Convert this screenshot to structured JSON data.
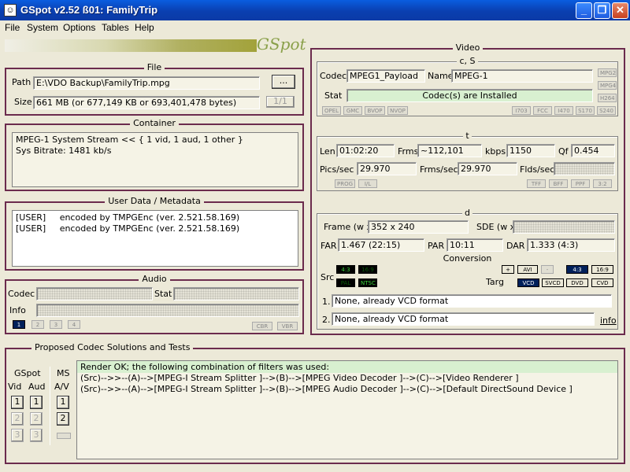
{
  "window": {
    "title": "GSpot v2.52 ß01: FamilyTrip"
  },
  "menu": [
    "File",
    "System",
    "Options",
    "Tables",
    "Help"
  ],
  "logo": "GSpot",
  "file": {
    "title": "File",
    "path_label": "Path",
    "path_value": "E:\\VDO Backup\\FamilyTrip.mpg",
    "browse_label": "...",
    "size_label": "Size",
    "size_value": "661 MB (or 677,149 KB or 693,401,478 bytes)",
    "counter": "1/1"
  },
  "container": {
    "title": "Container",
    "lines": "MPEG-1 System Stream << { 1 vid, 1 aud, 1 other }\nSys Bitrate: 1481 kb/s"
  },
  "userdata": {
    "title": "User Data / Metadata",
    "lines": "[USER]     encoded by TMPGEnc (ver. 2.521.58.169)\n[USER]     encoded by TMPGEnc (ver. 2.521.58.169)"
  },
  "audio": {
    "title": "Audio",
    "codec_label": "Codec",
    "stat_label": "Stat",
    "info_label": "Info",
    "streams": [
      "1",
      "2",
      "3",
      "4"
    ],
    "tags": [
      "CBR",
      "VBR"
    ]
  },
  "video": {
    "title": "Video",
    "cs": {
      "title": "c, S",
      "codec_label": "Codec",
      "codec_value": "MPEG1_Payload",
      "name_label": "Name",
      "name_value": "MPEG-1",
      "stat_label": "Stat",
      "stat_value": "Codec(s) are Installed",
      "side_tags": [
        "MPG2",
        "MPG4",
        "H264"
      ],
      "left_tags": [
        "OPEL",
        "GMC",
        "BVOP",
        "NVOP"
      ],
      "right_tags": [
        "I703",
        "FCC",
        "I470",
        "S170",
        "S240"
      ]
    },
    "t": {
      "title": "t",
      "len_label": "Len",
      "len_value": "01:02:20",
      "frms_label": "Frms",
      "frms_value": "~112,101",
      "kbps_label": "kbps",
      "kbps_value": "1150",
      "qf_label": "Qf",
      "qf_value": "0.454",
      "pics_label": "Pics/sec",
      "pics_value": "29.970",
      "fps_label": "Frms/sec",
      "fps_value": "29.970",
      "flds_label": "Flds/sec",
      "left_tags": [
        "PROG",
        "I/L"
      ],
      "right_tags": [
        "TFF",
        "BFF",
        "PPF",
        "3:2"
      ]
    },
    "d": {
      "title": "d",
      "frame_label": "Frame (w x",
      "frame_value": "352 x 240",
      "sde_label": "SDE (w x",
      "far_label": "FAR",
      "far_value": "1.467 (22:15)",
      "par_label": "PAR",
      "par_value": "10:11",
      "dar_label": "DAR",
      "dar_value": "1.333 (4:3)",
      "conversion_label": "Conversion",
      "src_label": "Src",
      "src_tags": [
        "4:3",
        "16:9",
        "PAL",
        "NTSC"
      ],
      "targ_label": "Targ",
      "targ_top": [
        "+",
        "AVI",
        "-",
        "4:3",
        "16:9"
      ],
      "targ_bottom": [
        "VCD",
        "SVCD",
        "DVD",
        "CVD"
      ],
      "row1_label": "1.",
      "row1_value": "None, already VCD format",
      "row2_label": "2.",
      "row2_value": "None, already VCD format",
      "info_link": "info"
    }
  },
  "proposed": {
    "title": "Proposed Codec Solutions and Tests",
    "gspot_label": "GSpot",
    "ms_label": "MS",
    "vid_label": "Vid",
    "aud_label": "Aud",
    "av_label": "A/V",
    "num1": "1",
    "num2": "2",
    "num3": "3",
    "result_line": "Render OK; the following combination of filters was used:",
    "filter_lines": "(Src)-->>--(A)-->[MPEG-I Stream Splitter ]-->(B)-->[MPEG Video Decoder ]-->(C)-->[Video Renderer ]\n(Src)-->>--(A)-->[MPEG-I Stream Splitter ]-->(B)-->[MPEG Audio Decoder ]-->(C)-->[Default DirectSound Device ]"
  }
}
